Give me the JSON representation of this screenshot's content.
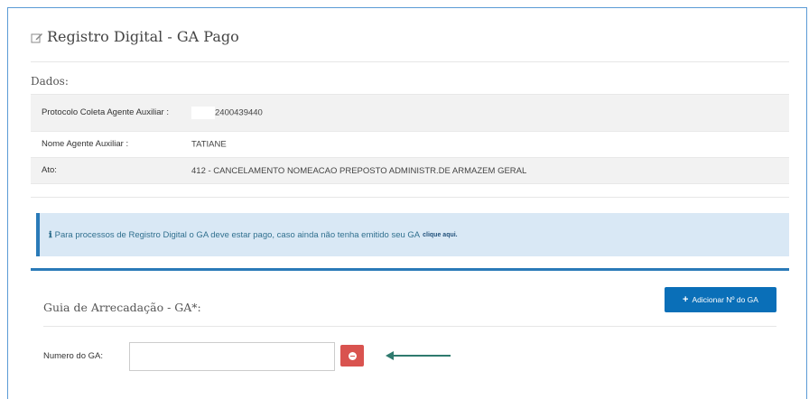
{
  "page": {
    "title": "Registro Digital - GA Pago",
    "title_icon": "edit-icon",
    "dados_label": "Dados:"
  },
  "info": {
    "rows": [
      {
        "key": "Protocolo Coleta Agente Auxiliar :",
        "value": "2400439440"
      },
      {
        "key": "Nome Agente Auxiliar :",
        "value": "TATIANE"
      },
      {
        "key": "Ato:",
        "value": "412 - CANCELAMENTO NOMEACAO PREPOSTO ADMINISTR.DE ARMAZEM GERAL"
      }
    ]
  },
  "alert": {
    "icon": "info-icon",
    "text": "Para processos de Registro Digital o GA deve estar pago, caso ainda não tenha emitido seu GA",
    "link": "clique aqui."
  },
  "ga_panel": {
    "title": "Guia de Arrecadação - GA*:",
    "add_button_label": "Adicionar Nº do GA",
    "numero_label": "Numero do GA:",
    "numero_value": "",
    "numero_placeholder": ""
  },
  "colors": {
    "primary": "#0a6fb8",
    "danger": "#d9534f",
    "alert_bg": "#d9e8f5",
    "arrow": "#2f7a6e"
  }
}
